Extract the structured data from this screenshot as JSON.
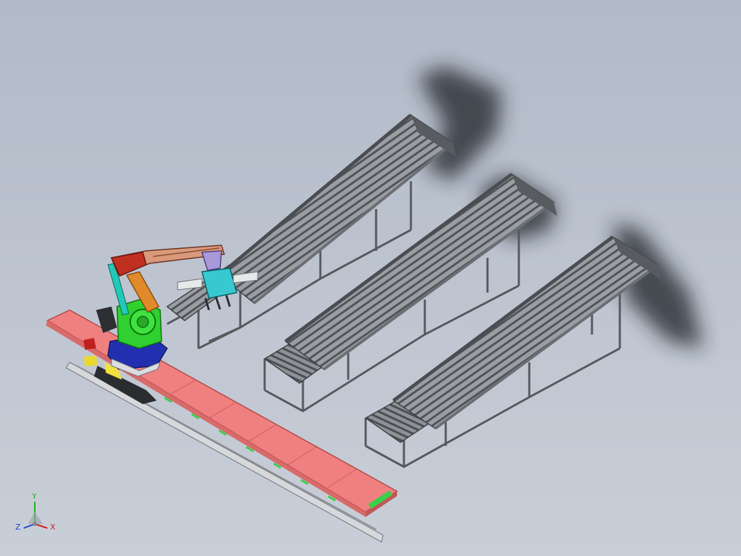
{
  "viewport": {
    "background_top": "#b2bac8",
    "background_bottom": "#c9cfd8"
  },
  "scene": {
    "robot": {
      "base_color": "#2230b0",
      "turret_color": "#2fd02f",
      "lower_arm_color": "#e08a2a",
      "upper_arm_color": "#c03020",
      "wrist_color": "#a89ad8",
      "gripper_color": "#38c8d0"
    },
    "track": {
      "color": "#f08080",
      "marker_color": "#3ad04a",
      "slot_count": 7
    },
    "conveyors": {
      "count": 3,
      "frame_color": "#5c5f63",
      "roller_color": "#8c8f94"
    }
  },
  "triad": {
    "y_label": "Y",
    "z_label": "Z",
    "x_label": "X",
    "x_color": "#d02020",
    "y_color": "#20b020",
    "z_color": "#2040d0"
  }
}
